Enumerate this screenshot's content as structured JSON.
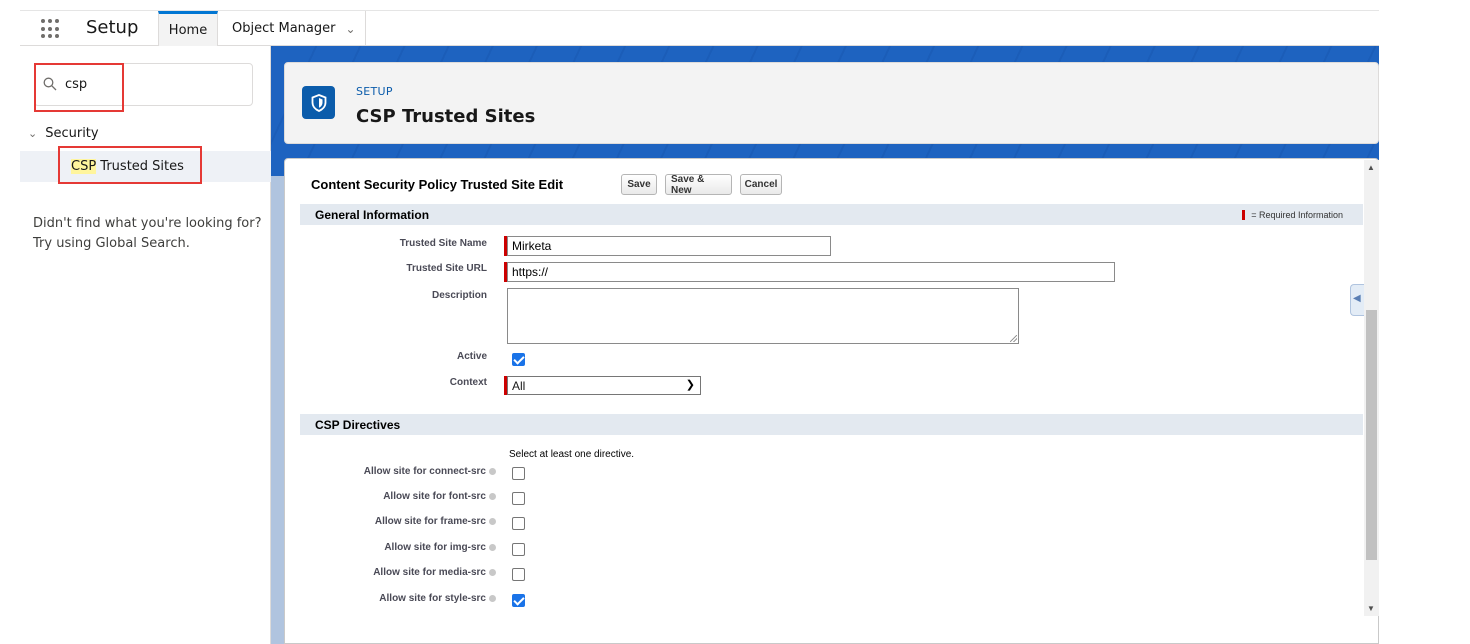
{
  "topbar": {
    "app_name": "Setup",
    "tabs": [
      {
        "label": "Home"
      },
      {
        "label": "Object Manager"
      }
    ]
  },
  "sidebar": {
    "search_value": "csp",
    "tree": {
      "parent_label": "Security",
      "child_highlight": "CSP",
      "child_rest": " Trusted Sites"
    },
    "not_found_line1": "Didn't find what you're looking for?",
    "not_found_line2": "Try using Global Search."
  },
  "header": {
    "eyebrow": "SETUP",
    "title": "CSP Trusted Sites"
  },
  "form": {
    "title": "Content Security Policy Trusted Site Edit",
    "buttons": {
      "save": "Save",
      "save_new": "Save & New",
      "cancel": "Cancel"
    },
    "general_section": "General Information",
    "required_legend": "= Required Information",
    "fields": {
      "name_label": "Trusted Site Name",
      "name_value": "Mirketa",
      "url_label": "Trusted Site URL",
      "url_value": "https://",
      "description_label": "Description",
      "active_label": "Active",
      "context_label": "Context",
      "context_value": "All"
    },
    "csp_section": "CSP Directives",
    "csp_hint": "Select at least one directive.",
    "directives": [
      {
        "label": "Allow site for connect-src",
        "checked": false
      },
      {
        "label": "Allow site for font-src",
        "checked": false
      },
      {
        "label": "Allow site for frame-src",
        "checked": false
      },
      {
        "label": "Allow site for img-src",
        "checked": false
      },
      {
        "label": "Allow site for media-src",
        "checked": false
      },
      {
        "label": "Allow site for style-src",
        "checked": true
      }
    ]
  },
  "colors": {
    "brand": "#0176d3",
    "required": "#cc0000",
    "checkbox_on": "#1a73e8",
    "annotation": "#e53935"
  }
}
